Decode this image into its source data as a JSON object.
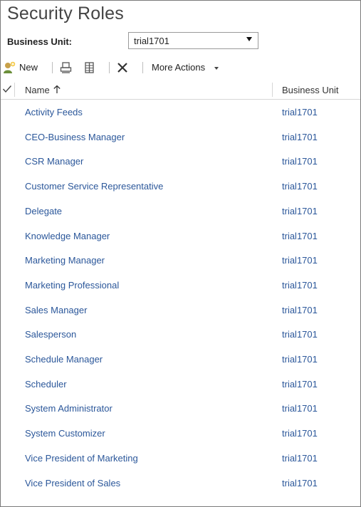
{
  "page": {
    "title": "Security Roles"
  },
  "business_unit": {
    "label": "Business Unit:",
    "selected": "trial1701"
  },
  "toolbar": {
    "new_label": "New",
    "more_actions_label": "More Actions"
  },
  "grid": {
    "columns": {
      "name": "Name",
      "business_unit": "Business Unit"
    },
    "rows": [
      {
        "name": "Activity Feeds",
        "bu": "trial1701"
      },
      {
        "name": "CEO-Business Manager",
        "bu": "trial1701"
      },
      {
        "name": "CSR Manager",
        "bu": "trial1701"
      },
      {
        "name": "Customer Service Representative",
        "bu": "trial1701"
      },
      {
        "name": "Delegate",
        "bu": "trial1701"
      },
      {
        "name": "Knowledge Manager",
        "bu": "trial1701"
      },
      {
        "name": "Marketing Manager",
        "bu": "trial1701"
      },
      {
        "name": "Marketing Professional",
        "bu": "trial1701"
      },
      {
        "name": "Sales Manager",
        "bu": "trial1701"
      },
      {
        "name": "Salesperson",
        "bu": "trial1701"
      },
      {
        "name": "Schedule Manager",
        "bu": "trial1701"
      },
      {
        "name": "Scheduler",
        "bu": "trial1701"
      },
      {
        "name": "System Administrator",
        "bu": "trial1701"
      },
      {
        "name": "System Customizer",
        "bu": "trial1701"
      },
      {
        "name": "Vice President of Marketing",
        "bu": "trial1701"
      },
      {
        "name": "Vice President of Sales",
        "bu": "trial1701"
      }
    ]
  },
  "icons": {
    "new": "new-record-icon",
    "print": "print-preview-icon",
    "export": "columns-icon",
    "delete": "delete-icon",
    "more_caret": "chevron-down-icon",
    "sort": "sort-ascending-icon",
    "select_all": "checkmark-icon",
    "dropdown": "dropdown-arrow-icon"
  },
  "colors": {
    "link": "#2b579a",
    "title": "#444444",
    "border": "#d6d6d6"
  }
}
